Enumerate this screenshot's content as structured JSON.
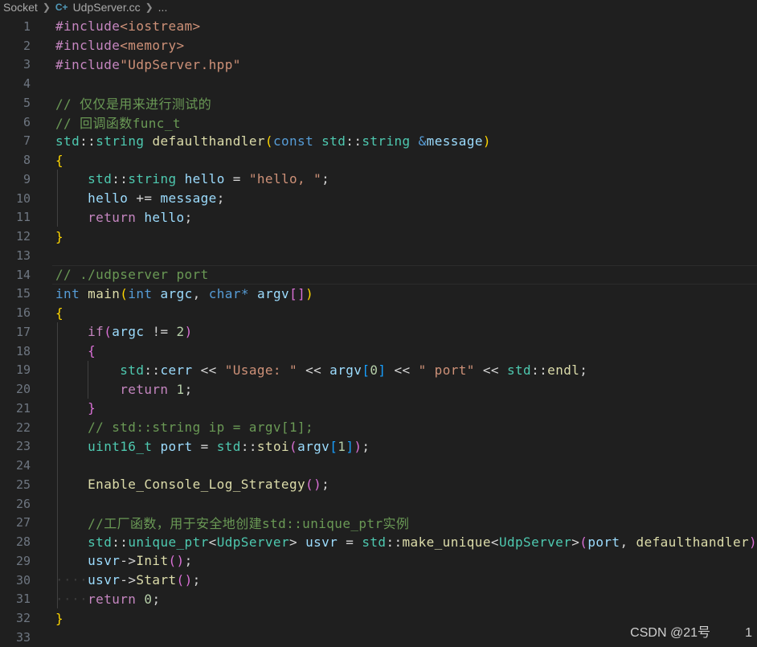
{
  "breadcrumb": {
    "folder": "Socket",
    "file_icon": "cpp-icon",
    "file_icon_glyph": "C+",
    "file": "UdpServer.cc",
    "ellipsis": "..."
  },
  "line_numbers": [
    "1",
    "2",
    "3",
    "4",
    "5",
    "6",
    "7",
    "8",
    "9",
    "10",
    "11",
    "12",
    "13",
    "14",
    "15",
    "16",
    "17",
    "18",
    "19",
    "20",
    "21",
    "22",
    "23",
    "24",
    "25",
    "26",
    "27",
    "28",
    "29",
    "30",
    "31",
    "32",
    "33"
  ],
  "code_lines": [
    [
      [
        "pp",
        "#include"
      ],
      [
        "inc",
        "<iostream>"
      ]
    ],
    [
      [
        "pp",
        "#include"
      ],
      [
        "inc",
        "<memory>"
      ]
    ],
    [
      [
        "pp",
        "#include"
      ],
      [
        "inc",
        "\"UdpServer.hpp\""
      ]
    ],
    [],
    [
      [
        "cm",
        "// 仅仅是用来进行测试的"
      ]
    ],
    [
      [
        "cm",
        "// 回调函数func_t"
      ]
    ],
    [
      [
        "ns",
        "std"
      ],
      [
        "plain",
        "::"
      ],
      [
        "ty",
        "string"
      ],
      [
        "plain",
        " "
      ],
      [
        "fn",
        "defaulthandler"
      ],
      [
        "br1",
        "("
      ],
      [
        "kw",
        "const"
      ],
      [
        "plain",
        " "
      ],
      [
        "ns",
        "std"
      ],
      [
        "plain",
        "::"
      ],
      [
        "ty",
        "string"
      ],
      [
        "plain",
        " "
      ],
      [
        "kw",
        "&"
      ],
      [
        "var",
        "message"
      ],
      [
        "br1",
        ")"
      ]
    ],
    [
      [
        "br1",
        "{"
      ]
    ],
    [
      [
        "plain",
        "    "
      ],
      [
        "ns",
        "std"
      ],
      [
        "plain",
        "::"
      ],
      [
        "ty",
        "string"
      ],
      [
        "plain",
        " "
      ],
      [
        "var",
        "hello"
      ],
      [
        "plain",
        " = "
      ],
      [
        "str",
        "\"hello, \""
      ],
      [
        "plain",
        ";"
      ]
    ],
    [
      [
        "plain",
        "    "
      ],
      [
        "var",
        "hello"
      ],
      [
        "plain",
        " += "
      ],
      [
        "var",
        "message"
      ],
      [
        "plain",
        ";"
      ]
    ],
    [
      [
        "plain",
        "    "
      ],
      [
        "ctl",
        "return"
      ],
      [
        "plain",
        " "
      ],
      [
        "var",
        "hello"
      ],
      [
        "plain",
        ";"
      ]
    ],
    [
      [
        "br1",
        "}"
      ]
    ],
    [],
    [
      [
        "cm",
        "// ./udpserver port"
      ]
    ],
    [
      [
        "kw",
        "int"
      ],
      [
        "plain",
        " "
      ],
      [
        "fn",
        "main"
      ],
      [
        "br1",
        "("
      ],
      [
        "kw",
        "int"
      ],
      [
        "plain",
        " "
      ],
      [
        "var",
        "argc"
      ],
      [
        "plain",
        ", "
      ],
      [
        "kw",
        "char"
      ],
      [
        "kw",
        "*"
      ],
      [
        "plain",
        " "
      ],
      [
        "var",
        "argv"
      ],
      [
        "br2",
        "[]"
      ],
      [
        "br1",
        ")"
      ]
    ],
    [
      [
        "br1",
        "{"
      ]
    ],
    [
      [
        "plain",
        "    "
      ],
      [
        "ctl",
        "if"
      ],
      [
        "br2",
        "("
      ],
      [
        "var",
        "argc"
      ],
      [
        "plain",
        " != "
      ],
      [
        "num",
        "2"
      ],
      [
        "br2",
        ")"
      ]
    ],
    [
      [
        "plain",
        "    "
      ],
      [
        "br2",
        "{"
      ]
    ],
    [
      [
        "plain",
        "        "
      ],
      [
        "ns",
        "std"
      ],
      [
        "plain",
        "::"
      ],
      [
        "var",
        "cerr"
      ],
      [
        "plain",
        " << "
      ],
      [
        "str",
        "\"Usage: \""
      ],
      [
        "plain",
        " << "
      ],
      [
        "var",
        "argv"
      ],
      [
        "br3",
        "["
      ],
      [
        "num",
        "0"
      ],
      [
        "br3",
        "]"
      ],
      [
        "plain",
        " << "
      ],
      [
        "str",
        "\" port\""
      ],
      [
        "plain",
        " << "
      ],
      [
        "ns",
        "std"
      ],
      [
        "plain",
        "::"
      ],
      [
        "fn",
        "endl"
      ],
      [
        "plain",
        ";"
      ]
    ],
    [
      [
        "plain",
        "        "
      ],
      [
        "ctl",
        "return"
      ],
      [
        "plain",
        " "
      ],
      [
        "num",
        "1"
      ],
      [
        "plain",
        ";"
      ]
    ],
    [
      [
        "plain",
        "    "
      ],
      [
        "br2",
        "}"
      ]
    ],
    [
      [
        "plain",
        "    "
      ],
      [
        "cm",
        "// std::string ip = argv[1];"
      ]
    ],
    [
      [
        "plain",
        "    "
      ],
      [
        "ty",
        "uint16_t"
      ],
      [
        "plain",
        " "
      ],
      [
        "var",
        "port"
      ],
      [
        "plain",
        " = "
      ],
      [
        "ns",
        "std"
      ],
      [
        "plain",
        "::"
      ],
      [
        "fn",
        "stoi"
      ],
      [
        "br2",
        "("
      ],
      [
        "var",
        "argv"
      ],
      [
        "br3",
        "["
      ],
      [
        "num",
        "1"
      ],
      [
        "br3",
        "]"
      ],
      [
        "br2",
        ")"
      ],
      [
        "plain",
        ";"
      ]
    ],
    [],
    [
      [
        "plain",
        "    "
      ],
      [
        "fn",
        "Enable_Console_Log_Strategy"
      ],
      [
        "br2",
        "()"
      ],
      [
        "plain",
        ";"
      ]
    ],
    [],
    [
      [
        "plain",
        "    "
      ],
      [
        "cm",
        "//工厂函数，用于安全地创建std::unique_ptr实例"
      ]
    ],
    [
      [
        "plain",
        "    "
      ],
      [
        "ns",
        "std"
      ],
      [
        "plain",
        "::"
      ],
      [
        "ty",
        "unique_ptr"
      ],
      [
        "plain",
        "<"
      ],
      [
        "ty",
        "UdpServer"
      ],
      [
        "plain",
        "> "
      ],
      [
        "var",
        "usvr"
      ],
      [
        "plain",
        " = "
      ],
      [
        "ns",
        "std"
      ],
      [
        "plain",
        "::"
      ],
      [
        "fn",
        "make_unique"
      ],
      [
        "plain",
        "<"
      ],
      [
        "ty",
        "UdpServer"
      ],
      [
        "plain",
        ">"
      ],
      [
        "br2",
        "("
      ],
      [
        "var",
        "port"
      ],
      [
        "plain",
        ", "
      ],
      [
        "fn",
        "defaulthandler"
      ],
      [
        "br2",
        ")"
      ],
      [
        "plain",
        ";"
      ]
    ],
    [
      [
        "plain",
        "    "
      ],
      [
        "var",
        "usvr"
      ],
      [
        "plain",
        "->"
      ],
      [
        "fn",
        "Init"
      ],
      [
        "br2",
        "()"
      ],
      [
        "plain",
        ";"
      ]
    ],
    [
      [
        "ws",
        "····"
      ],
      [
        "var",
        "usvr"
      ],
      [
        "plain",
        "->"
      ],
      [
        "fn",
        "Start"
      ],
      [
        "br2",
        "()"
      ],
      [
        "plain",
        ";"
      ]
    ],
    [
      [
        "ws",
        "····"
      ],
      [
        "ctl",
        "return"
      ],
      [
        "plain",
        " "
      ],
      [
        "num",
        "0"
      ],
      [
        "plain",
        ";"
      ]
    ],
    [
      [
        "br1",
        "}"
      ]
    ],
    []
  ],
  "watermark": "CSDN @21号",
  "page_indicator": "1"
}
